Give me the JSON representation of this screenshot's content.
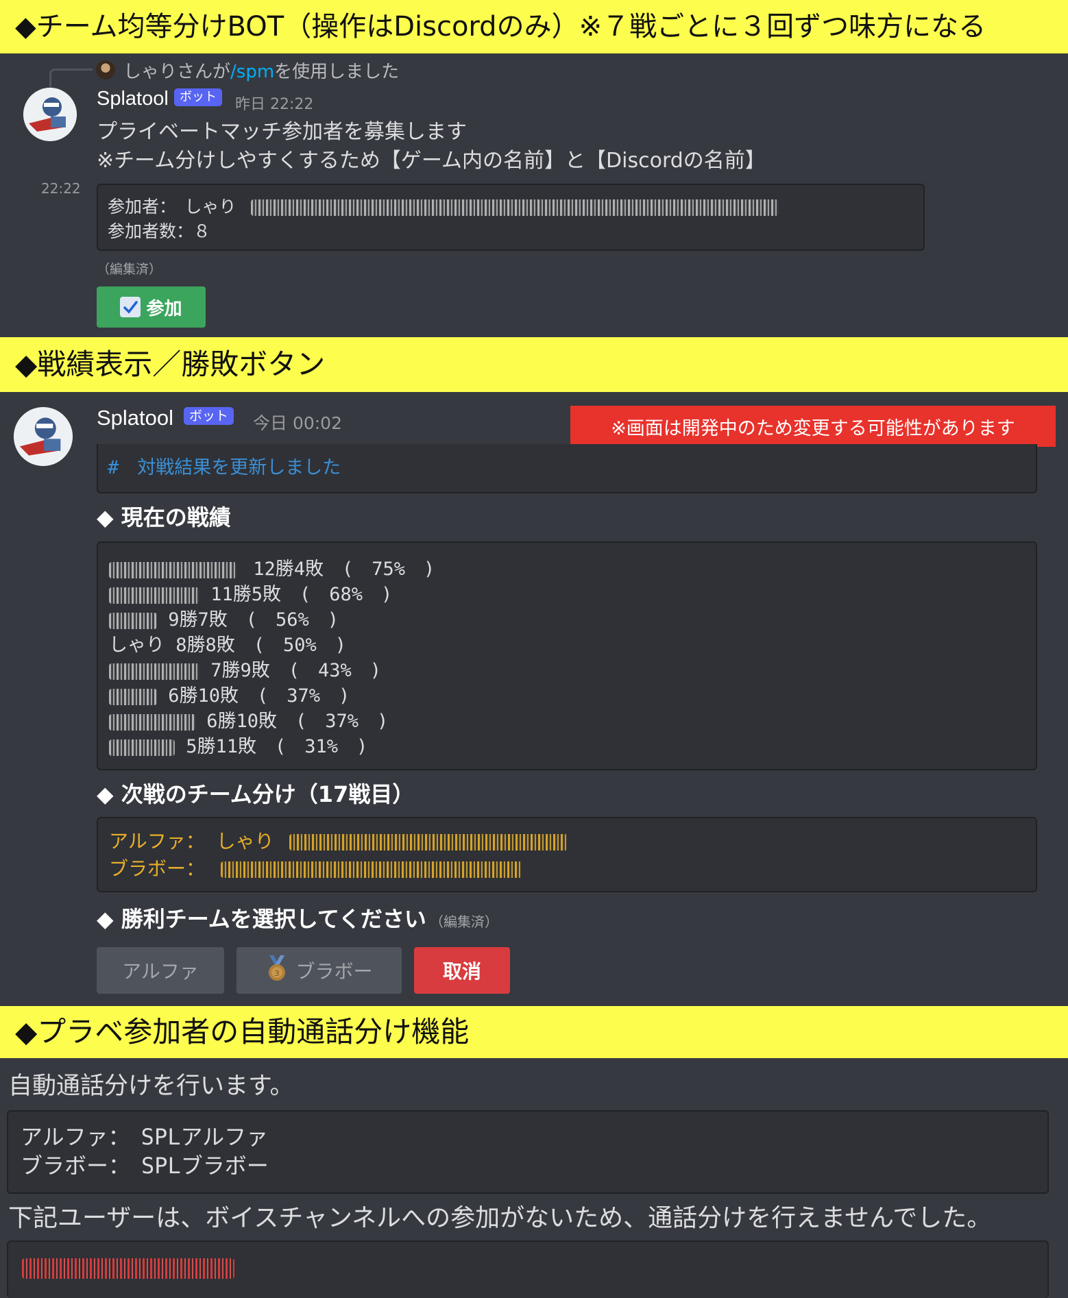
{
  "banners": {
    "top": "◆チーム均等分けBOT（操作はDiscordのみ）※７戦ごとに３回ずつ味方になる",
    "stats": "◆戦績表示／勝敗ボタン",
    "voice": "◆プラベ参加者の自動通話分け機能"
  },
  "recruit": {
    "reply_text": "しゃりさんが",
    "reply_command": "/spm",
    "reply_suffix": "を使用しました",
    "username": "Splatool",
    "bot_tag": "ボット",
    "timestamp": "昨日 22:22",
    "line1": "プライベートマッチ参加者を募集します",
    "line2": "※チーム分けしやすくするため【ゲーム内の名前】と【Discordの名前】",
    "side_time": "22:22",
    "participants_label": "参加者：　しゃり",
    "count_label": "参加者数：８",
    "edited": "（編集済）",
    "join_button": "参加",
    "join_icon": "checkmark-icon"
  },
  "results": {
    "username": "Splatool",
    "bot_tag": "ボット",
    "timestamp": "今日 00:02",
    "notice": "※画面は開発中のため変更する可能性があります",
    "notice_color": "#e8322c",
    "updated_header": "#　対戦結果を更新しました",
    "current_heading": "◆ 現在の戦績",
    "records": [
      {
        "name": "",
        "text": "12勝4敗　(　75%　)"
      },
      {
        "name": "",
        "text": "11勝5敗　(　68%　)"
      },
      {
        "name": "",
        "text": "9勝7敗　(　56%　)"
      },
      {
        "name": "しゃり",
        "text": "8勝8敗　(　50%　)"
      },
      {
        "name": "",
        "text": "7勝9敗　(　43%　)"
      },
      {
        "name": "",
        "text": "6勝10敗　(　37%　)"
      },
      {
        "name": "",
        "text": "6勝10敗　(　37%　)"
      },
      {
        "name": "",
        "text": "5勝11敗　(　31%　)"
      }
    ],
    "next_heading": "◆ 次戦のチーム分け（17戦目）",
    "alpha_label": "アルファ：",
    "alpha_first": "しゃり",
    "bravo_label": "ブラボー：",
    "select_heading": "◆ 勝利チームを選択してください",
    "select_edited": "（編集済）",
    "buttons": {
      "alpha": "アルファ",
      "bravo": "ブラボー",
      "cancel": "取消"
    },
    "bravo_icon": "medal-icon",
    "cancel_color": "#d83c3e",
    "team_color": "#e8af28"
  },
  "voice": {
    "intro": "自動通話分けを行います。",
    "alpha_line": "アルファ：　SPLアルファ",
    "bravo_line": "ブラボー：　SPLブラボー",
    "warning": "下記ユーザーは、ボイスチャンネルへの参加がないため、通話分けを行えませんでした。"
  }
}
